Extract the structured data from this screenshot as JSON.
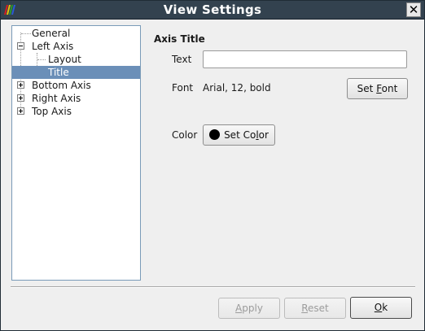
{
  "window": {
    "title": "View Settings",
    "close_glyph": "✕",
    "icon": "app-stripes-icon",
    "icon_colors": [
      "#d81e1e",
      "#e8c20c",
      "#2a9a2a",
      "#2a5bd8"
    ]
  },
  "tree": {
    "items": [
      {
        "label": "General",
        "expander": "none",
        "level": 0
      },
      {
        "label": "Left Axis",
        "expander": "expanded",
        "level": 0
      },
      {
        "label": "Layout",
        "expander": "none",
        "level": 1
      },
      {
        "label": "Title",
        "expander": "none",
        "level": 1,
        "selected": true
      },
      {
        "label": "Bottom Axis",
        "expander": "collapsed",
        "level": 0
      },
      {
        "label": "Right Axis",
        "expander": "collapsed",
        "level": 0
      },
      {
        "label": "Top Axis",
        "expander": "collapsed",
        "level": 0
      }
    ],
    "selection_color": "#6b8fb8"
  },
  "panel": {
    "section_title": "Axis Title",
    "text_label": "Text",
    "text_value": "",
    "font_label": "Font",
    "font_value": "Arial, 12, bold",
    "set_font": {
      "pre": "Set ",
      "mnemonic": "F",
      "post": "ont"
    },
    "color_label": "Color",
    "color_value": "#000000",
    "set_color": {
      "pre": "Set Co",
      "mnemonic": "l",
      "post": "or"
    }
  },
  "footer": {
    "apply": {
      "pre": "",
      "mnemonic": "A",
      "post": "pply",
      "enabled": false
    },
    "reset": {
      "pre": "",
      "mnemonic": "R",
      "post": "eset",
      "enabled": false
    },
    "ok": {
      "pre": "",
      "mnemonic": "O",
      "post": "k",
      "enabled": true
    }
  }
}
